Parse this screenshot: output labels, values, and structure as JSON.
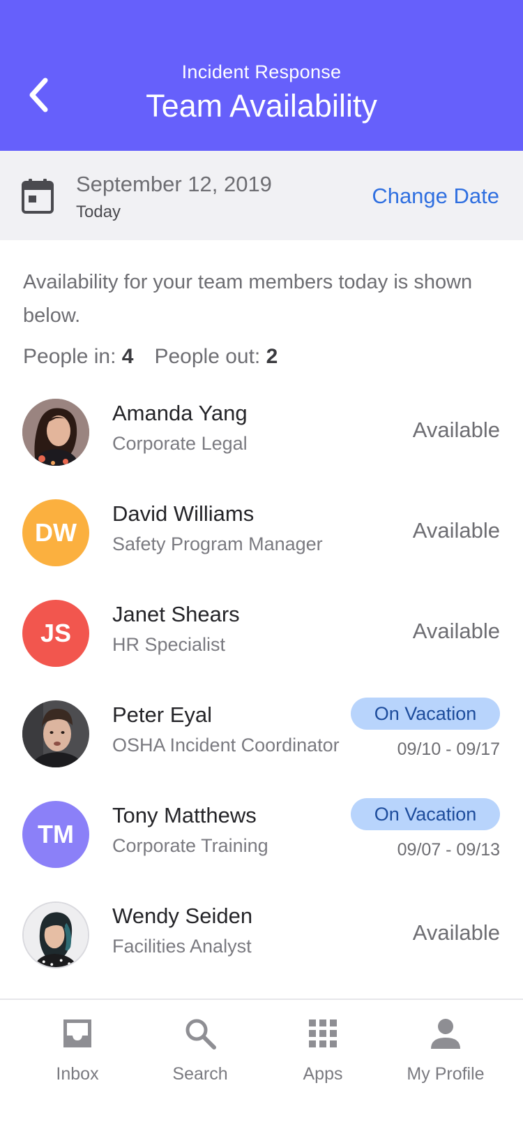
{
  "header": {
    "subtitle": "Incident Response",
    "title": "Team Availability"
  },
  "date_bar": {
    "date": "September 12, 2019",
    "relative": "Today",
    "change_label": "Change Date"
  },
  "intro_text": "Availability for your team members today is shown below.",
  "counts": {
    "in_label": "People in:",
    "in_value": "4",
    "out_label": "People out:",
    "out_value": "2"
  },
  "people": [
    {
      "name": "Amanda Yang",
      "role": "Corporate Legal",
      "status": "Available"
    },
    {
      "name": "David Williams",
      "role": "Safety Program Manager",
      "status": "Available",
      "initials": "DW",
      "color": "#fbb03f"
    },
    {
      "name": "Janet Shears",
      "role": "HR Specialist",
      "status": "Available",
      "initials": "JS",
      "color": "#f2564e"
    },
    {
      "name": "Peter Eyal",
      "role": "OSHA Incident Coordinator",
      "status": "On Vacation",
      "dates": "09/10 - 09/17"
    },
    {
      "name": "Tony Matthews",
      "role": "Corporate Training",
      "status": "On Vacation",
      "dates": "09/07 - 09/13",
      "initials": "TM",
      "color": "#8b80f8"
    },
    {
      "name": "Wendy Seiden",
      "role": "Facilities Analyst",
      "status": "Available"
    }
  ],
  "tabs": [
    {
      "label": "Inbox",
      "icon": "inbox-icon"
    },
    {
      "label": "Search",
      "icon": "search-icon"
    },
    {
      "label": "Apps",
      "icon": "apps-grid-icon"
    },
    {
      "label": "My Profile",
      "icon": "profile-icon"
    }
  ],
  "colors": {
    "header_bg": "#6660fb",
    "link": "#2f6fe0",
    "vacation_badge_bg": "#b8d4fc",
    "vacation_badge_text": "#1d4c9c"
  }
}
